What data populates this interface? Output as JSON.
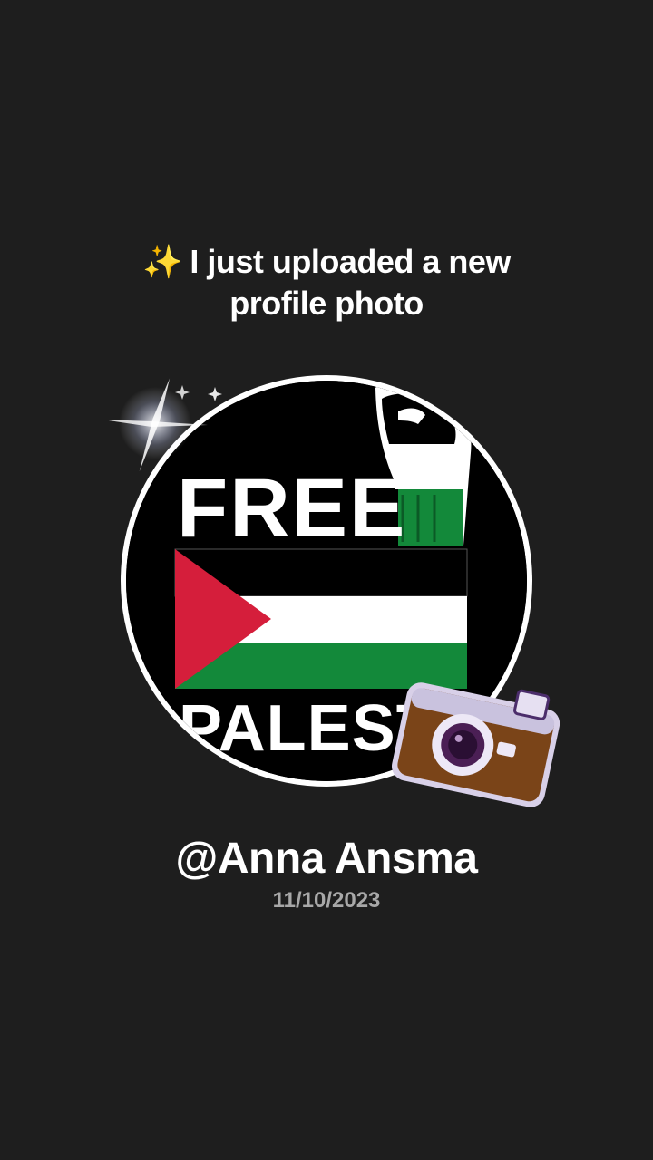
{
  "headline": {
    "sparkle": "✨",
    "text": "I just uploaded a new profile photo"
  },
  "avatar": {
    "top_text": "FREE",
    "bottom_text": "PALESTI",
    "flag_colors": {
      "black": "#000000",
      "white": "#ffffff",
      "green": "#13893a",
      "red": "#d51e3b"
    },
    "icon": "raised-fist-icon"
  },
  "decorations": {
    "camera_icon": "camera-icon",
    "sparkle_icon": "sparkle-glint-icon"
  },
  "profile": {
    "username": "@Anna Ansma",
    "date": "11/10/2023"
  },
  "theme": {
    "background": "#1e1e1e",
    "text_primary": "#ffffff",
    "text_secondary": "#a8a8a8"
  }
}
